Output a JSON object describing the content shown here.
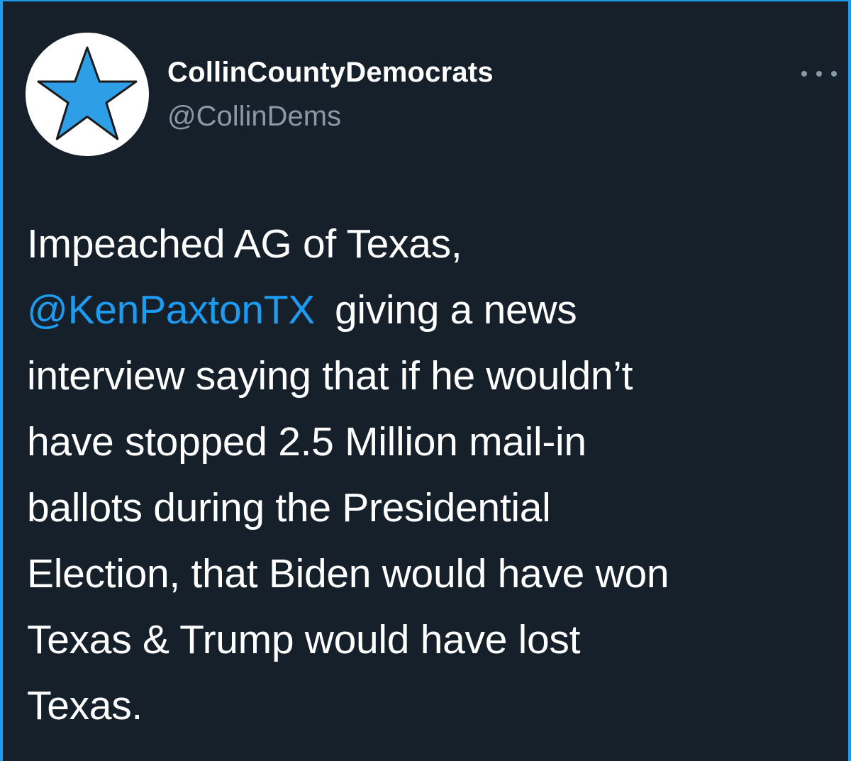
{
  "profile": {
    "display_name": "CollinCountyDemocrats",
    "handle": "@CollinDems",
    "avatar_icon": "star-icon",
    "avatar_color": "#2e9fe6"
  },
  "menu": {
    "more_icon": "more-horizontal-icon"
  },
  "tweet": {
    "line_1": "Impeached AG of Texas,",
    "mention": "@KenPaxtonTX",
    "line_2_rest": "giving a news",
    "line_3": "interview saying that if he wouldn’t",
    "line_4": "have stopped 2.5 Million mail-in",
    "line_5": "ballots during the Presidential",
    "line_6": "Election, that Biden would have won",
    "line_7": "Texas & Trump would have lost",
    "line_8": "Texas."
  },
  "colors": {
    "background": "#15202b",
    "accent": "#1d9bf0",
    "secondary_text": "#8b98a5"
  }
}
